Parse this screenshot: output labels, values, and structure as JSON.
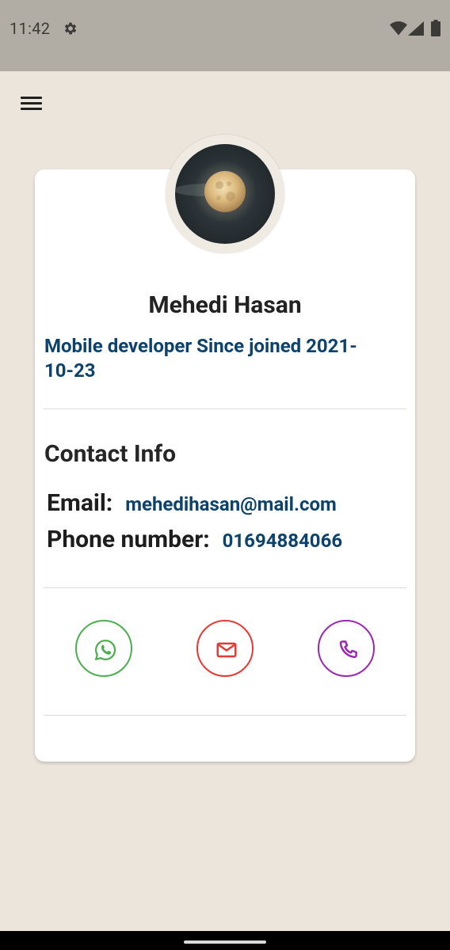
{
  "status_bar": {
    "time": "11:42",
    "icons": [
      "gear-icon",
      "wifi-icon",
      "signal-icon",
      "battery-icon"
    ]
  },
  "app_bar": {
    "menu_icon": "menu-icon"
  },
  "profile": {
    "avatar": "moon-photo",
    "name": "Mehedi Hasan",
    "subtitle": "Mobile developer Since joined 2021-10-23"
  },
  "contact": {
    "title": "Contact Info",
    "email_label": "Email:",
    "email_value": "mehedihasan@mail.com",
    "phone_label": "Phone number:",
    "phone_value": "01694884066"
  },
  "actions": [
    {
      "name": "whatsapp",
      "icon": "whatsapp-icon",
      "color": "#4caf50"
    },
    {
      "name": "email",
      "icon": "mail-icon",
      "color": "#e53935"
    },
    {
      "name": "phone",
      "icon": "phone-icon",
      "color": "#9c27b0"
    }
  ],
  "colors": {
    "background": "#ece5dc",
    "accent_text": "#0c426b",
    "status_bar": "#b1ada4"
  }
}
